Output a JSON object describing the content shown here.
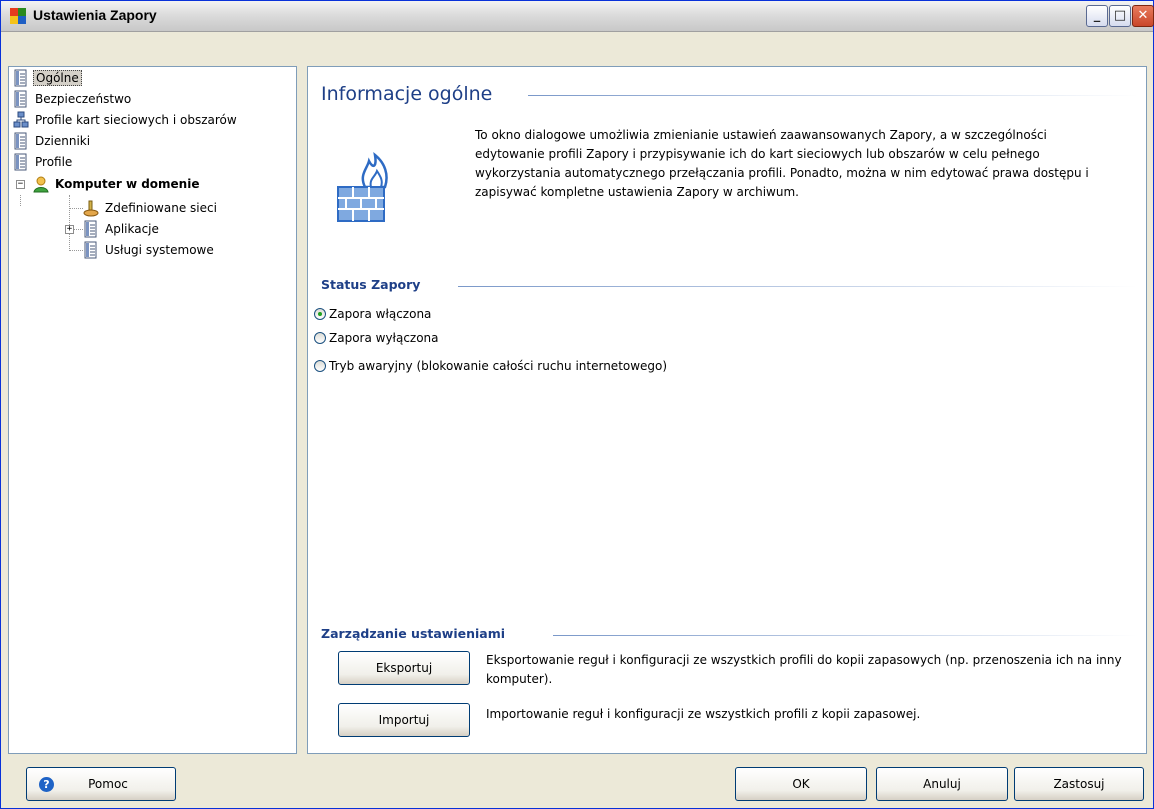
{
  "window": {
    "title": "Ustawienia Zapory",
    "min_symbol": "_",
    "max_symbol": "□",
    "close_symbol": "✕"
  },
  "tree": {
    "items": [
      {
        "label": "Ogólne"
      },
      {
        "label": "Bezpieczeństwo"
      },
      {
        "label": "Profile kart sieciowych i obszarów"
      },
      {
        "label": "Dzienniki"
      },
      {
        "label": "Profile"
      },
      {
        "label": "Komputer w domenie"
      },
      {
        "label": "Zdefiniowane sieci"
      },
      {
        "label": "Aplikacje"
      },
      {
        "label": "Usługi systemowe"
      }
    ],
    "collapse_symbol": "−",
    "expand_symbol": "+"
  },
  "content": {
    "heading": "Informacje ogólne",
    "description": "To okno dialogowe umożliwia zmienianie ustawień zaawansowanych Zapory, a w szczególności edytowanie profili Zapory i przypisywanie ich do kart sieciowych lub obszarów w celu pełnego wykorzystania automatycznego przełączania profili. Ponadto, można w nim edytować prawa dostępu i zapisywać kompletne ustawienia Zapory w archiwum.",
    "status": {
      "heading": "Status Zapory",
      "options": [
        {
          "label": "Zapora włączona",
          "checked": true
        },
        {
          "label": "Zapora wyłączona",
          "checked": false
        },
        {
          "label": "Tryb awaryjny (blokowanie całości ruchu internetowego)",
          "checked": false
        }
      ]
    },
    "management": {
      "heading": "Zarządzanie ustawieniami",
      "export_label": "Eksportuj",
      "export_desc": "Eksportowanie reguł i konfiguracji ze wszystkich profili do kopii zapasowych (np. przenoszenia ich na inny komputer).",
      "import_label": "Importuj",
      "import_desc": "Importowanie reguł i konfiguracji ze wszystkich profili z kopii zapasowej."
    }
  },
  "footer": {
    "help_label": "Pomoc",
    "ok_label": "OK",
    "cancel_label": "Anuluj",
    "apply_label": "Zastosuj"
  },
  "colors": {
    "heading": "#1e3f87",
    "window_bg": "#ece9d8",
    "panel_border": "#7f9db9"
  }
}
